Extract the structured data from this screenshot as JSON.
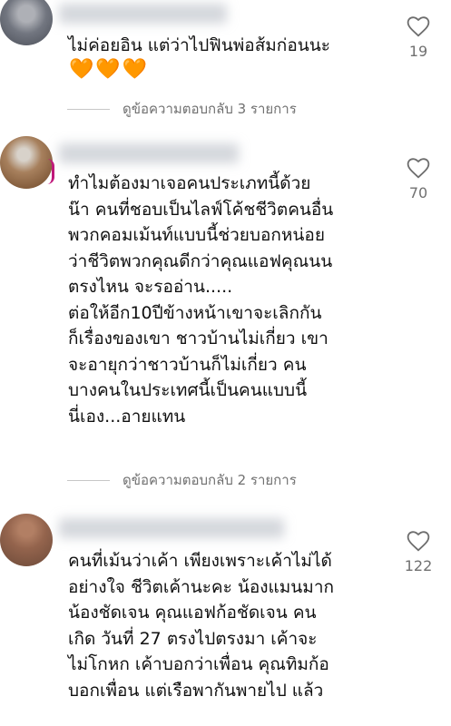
{
  "comments": [
    {
      "text": "ไม่ค่อยอิน แต่ว่าไปฟินพ่อส้มก่อนนะ",
      "emoji": "🧡🧡🧡",
      "like_count": "19",
      "reply_label": "ดูข้อความตอบกลับ 3 รายการ"
    },
    {
      "text": "ทำไมต้องมาเจอคนประเภทนี้ด้วย\nน๊า คนที่ชอบเป็นไลฟ์โค้ชชีวิตคนอื่น\nพวกคอมเม้นท์แบบนี้ช่วยบอกหน่อย\nว่าชีวิตพวกคุณดีกว่าคุณแอฟคุณนน\nตรงไหน จะรออ่าน.....\nต่อให้อีก10ปีข้างหน้าเขาจะเลิกกัน\nก็เรื่องของเขา ชาวบ้านไม่เกี่ยว เขา\nจะอายุกว่าชาวบ้านก็ไม่เกี่ยว คน\nบางคนในประเทศนี้เป็นคนแบบนี้\nนี่เอง...อายแทน",
      "like_count": "70",
      "reply_label": "ดูข้อความตอบกลับ 2 รายการ"
    },
    {
      "text": "คนที่เม้นว่าเค้า เพียงเพราะเค้าไม่ได้\nอย่างใจ ชีวิตเค้านะคะ น้องแมนมาก\nน้องชัดเจน คุณแอฟก้อชัดเจน คน\nเกิด วันที่ 27 ตรงไปตรงมา เค้าจะ\nไม่โกหก เค้าบอกว่าเพื่อน คุณทิมก้อ\nบอกเพื่อน แต่เรือพากันพายไป แล้ว",
      "like_count": "122"
    }
  ],
  "colors": {
    "text": "#111111",
    "muted": "#707070",
    "heart_outline": "#6e6e6e",
    "story_ring": "#c0177a",
    "emoji_heart": "#f1a125"
  }
}
